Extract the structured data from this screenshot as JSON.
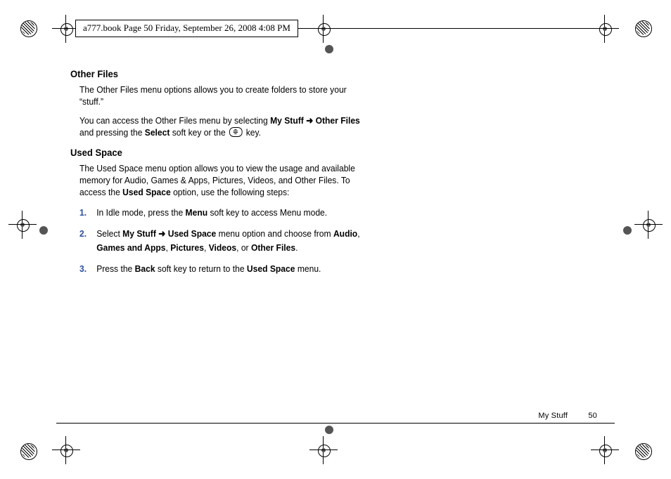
{
  "header": {
    "meta_text": "a777.book  Page 50  Friday, September 26, 2008  4:08 PM"
  },
  "sections": {
    "other_files": {
      "heading": "Other Files",
      "p1_a": "The Other Files menu options allows you to create folders to store your “stuff.”",
      "p2_a": "You can access the Other Files menu by selecting ",
      "p2_b_mystuff": "My Stuff",
      "p2_arrow": " ➜ ",
      "p2_b_other": "Other Files",
      "p2_c": " and pressing the ",
      "p2_b_select": "Select",
      "p2_d": " soft key or the ",
      "p2_e": " key."
    },
    "used_space": {
      "heading": "Used Space",
      "p1_a": "The Used Space menu option allows you to view the usage and available memory for Audio, Games & Apps, Pictures, Videos, and Other Files. To access the ",
      "p1_b": "Used Space",
      "p1_c": " option, use the following steps:",
      "steps": [
        {
          "num": "1.",
          "a": "In Idle mode, press the ",
          "b1": "Menu",
          "c": " soft key to access Menu mode."
        },
        {
          "num": "2.",
          "a": "Select ",
          "b1": "My Stuff ",
          "arrow": " ➜ ",
          "b2": "Used Space",
          "c": " menu option and choose from ",
          "b3": "Audio",
          "d": ", ",
          "b4": "Games and Apps",
          "e": ", ",
          "b5": "Pictures",
          "f": ", ",
          "b6": "Videos",
          "g": ", or ",
          "b7": "Other Files",
          "h": "."
        },
        {
          "num": "3.",
          "a": "Press the ",
          "b1": "Back",
          "c": " soft key to return to the ",
          "b2": "Used Space",
          "d": " menu."
        }
      ]
    }
  },
  "footer": {
    "section": "My Stuff",
    "page": "50"
  }
}
